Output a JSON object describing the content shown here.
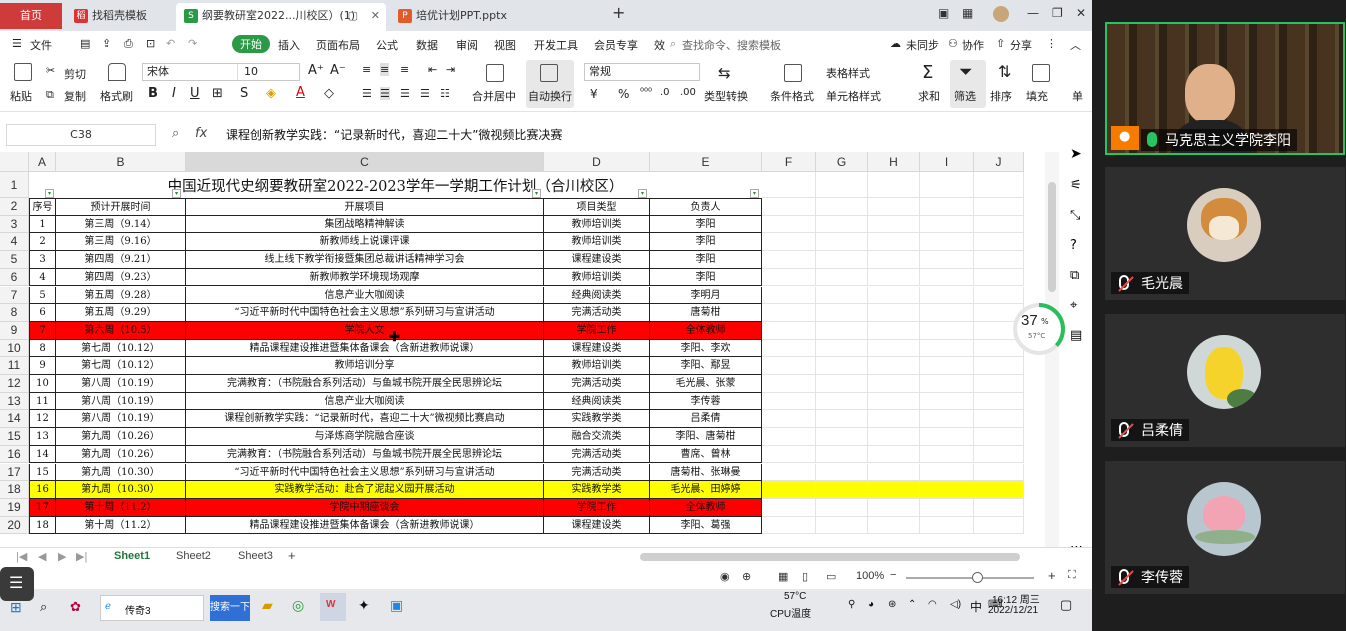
{
  "tabs": {
    "home": "首页",
    "tab1": "找稻壳模板",
    "tab2": "纲要教研室2022...川校区）(1)",
    "tab3": "培优计划PPT.pptx",
    "new": "+"
  },
  "menu": [
    "文件",
    "开始",
    "插入",
    "页面布局",
    "公式",
    "数据",
    "审阅",
    "视图",
    "开发工具",
    "会员专享",
    "效"
  ],
  "menu_search": "查找命令、搜索模板",
  "menu_right": [
    "未同步",
    "协作",
    "分享"
  ],
  "ribbon": {
    "cut": "剪切",
    "paste": "粘贴",
    "copy": "复制",
    "format_painter": "格式刷",
    "font": "宋体",
    "font_size": "10",
    "merge_center": "合并居中",
    "wrap": "自动换行",
    "number_format": "常规",
    "type_convert": "类型转换",
    "cond_format": "条件格式",
    "table_style": "表格样式",
    "cell_style": "单元格样式",
    "sum": "求和",
    "filter": "筛选",
    "sort": "排序",
    "fill": "填充",
    "single": "单"
  },
  "formula": {
    "cell_ref": "C38",
    "fx": "fx",
    "content": "课程创新教学实践：“记录新时代，喜迎二十大”微视频比赛决赛"
  },
  "columns": [
    "A",
    "B",
    "C",
    "D",
    "E",
    "F",
    "G",
    "H",
    "I",
    "J"
  ],
  "sheet": {
    "title": "中国近现代史纲要教研室2022-2023学年一学期工作计划（合川校区）",
    "headers": [
      "序号",
      "预计开展时间",
      "开展项目",
      "项目类型",
      "负责人"
    ],
    "rows": [
      {
        "r": "3",
        "c": [
          "1",
          "第三周（9.14）",
          "集团战略精神解读",
          "教师培训类",
          "李阳"
        ],
        "hl": ""
      },
      {
        "r": "4",
        "c": [
          "2",
          "第三周（9.16）",
          "新教师线上说课评课",
          "教师培训类",
          "李阳"
        ],
        "hl": ""
      },
      {
        "r": "5",
        "c": [
          "3",
          "第四周（9.21）",
          "线上线下教学衔接暨集团总裁讲话精神学习会",
          "课程建设类",
          "李阳"
        ],
        "hl": ""
      },
      {
        "r": "6",
        "c": [
          "4",
          "第四周（9.23）",
          "新教师教学环境现场观摩",
          "教师培训类",
          "李阳"
        ],
        "hl": ""
      },
      {
        "r": "7",
        "c": [
          "5",
          "第五周（9.28）",
          "信息产业大咖阅读",
          "经典阅读类",
          "李明月"
        ],
        "hl": ""
      },
      {
        "r": "8",
        "c": [
          "6",
          "第五周（9.29）",
          "“习近平新时代中国特色社会主义思想”系列研习与宣讲活动",
          "完满活动类",
          "唐菊柑"
        ],
        "hl": ""
      },
      {
        "r": "9",
        "c": [
          "7",
          "第六周（10.5）",
          "学院人文",
          "学院工作",
          "全体教师"
        ],
        "hl": "red"
      },
      {
        "r": "10",
        "c": [
          "8",
          "第七周（10.12）",
          "精品课程建设推进暨集体备课会（含新进教师说课）",
          "课程建设类",
          "李阳、李欢"
        ],
        "hl": ""
      },
      {
        "r": "11",
        "c": [
          "9",
          "第七周（10.12）",
          "教师培训分享",
          "教师培训类",
          "李阳、鄢昱"
        ],
        "hl": ""
      },
      {
        "r": "12",
        "c": [
          "10",
          "第八周（10.19）",
          "完满教育：（书院融合系列活动）与鱼城书院开展全民思辨论坛",
          "完满活动类",
          "毛光晨、张蒙"
        ],
        "hl": ""
      },
      {
        "r": "13",
        "c": [
          "11",
          "第八周（10.19）",
          "信息产业大咖阅读",
          "经典阅读类",
          "李传蓉"
        ],
        "hl": ""
      },
      {
        "r": "14",
        "c": [
          "12",
          "第八周（10.19）",
          "课程创新教学实践：“记录新时代，喜迎二十大”微视频比赛启动",
          "实践教学类",
          "吕柔倩"
        ],
        "hl": ""
      },
      {
        "r": "15",
        "c": [
          "13",
          "第九周（10.26）",
          "与泽炼商学院融合座谈",
          "融合交流类",
          "李阳、唐菊柑"
        ],
        "hl": ""
      },
      {
        "r": "16",
        "c": [
          "14",
          "第九周（10.26）",
          "完满教育：（书院融合系列活动）与鱼城书院开展全民思辨论坛",
          "完满活动类",
          "曹席、曾林"
        ],
        "hl": ""
      },
      {
        "r": "17",
        "c": [
          "15",
          "第九周（10.30）",
          "“习近平新时代中国特色社会主义思想”系列研习与宣讲活动",
          "完满活动类",
          "唐菊柑、张琳曼"
        ],
        "hl": ""
      },
      {
        "r": "18",
        "c": [
          "16",
          "第九周（10.30）",
          "实践教学活动：赴合了泥起义园开展活动",
          "实践教学类",
          "毛光晨、田婷婷"
        ],
        "hl": "yellow"
      },
      {
        "r": "19",
        "c": [
          "17",
          "第十周（11.2）",
          "学院中期座谈会",
          "学院工作",
          "全体教师"
        ],
        "hl": "red"
      },
      {
        "r": "20",
        "c": [
          "18",
          "第十周（11.2）",
          "精品课程建设推进暨集体备课会（含新进教师说课）",
          "课程建设类",
          "李阳、葛强"
        ],
        "hl": ""
      }
    ]
  },
  "sheet_tabs": [
    "Sheet1",
    "Sheet2",
    "Sheet3"
  ],
  "status": {
    "zoom": "100%"
  },
  "cpu": {
    "percent": "37",
    "unit": "%",
    "temp": "57°C"
  },
  "taskbar": {
    "app1": "传奇3",
    "search": "搜索一下",
    "cpu_temp": "57°C",
    "cpu_label": "CPU温度",
    "ime": "中",
    "time": "16:12 周三",
    "date": "2022/12/21"
  },
  "participants": [
    {
      "name": "马克思主义学院李阳",
      "mic": "on",
      "video": true
    },
    {
      "name": "毛光晨",
      "mic": "muted",
      "avatar": "dog"
    },
    {
      "name": "吕柔倩",
      "mic": "muted",
      "avatar": "pikachu"
    },
    {
      "name": "李传蓉",
      "mic": "muted",
      "avatar": "lotus"
    }
  ],
  "colors": {
    "red": "#ff0000",
    "yellow": "#ffff00",
    "accent": "#2b9a47",
    "active_border": "#27c463"
  }
}
